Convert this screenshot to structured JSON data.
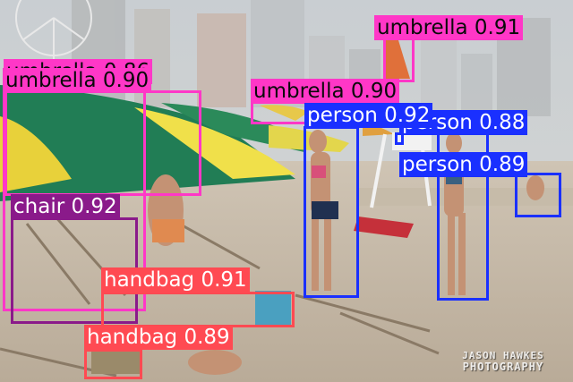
{
  "colors": {
    "umbrella": "#ff37c7",
    "person": "#1a30ff",
    "chair": "#8a1a8a",
    "handbag": "#ff4a52"
  },
  "detections": [
    {
      "label": "umbrella 0.91",
      "cls": "umbrella"
    },
    {
      "label": "umbrella 0.90",
      "cls": "umbrella"
    },
    {
      "label": "umbrella 0.90",
      "cls": "umbrella"
    },
    {
      "label": "umbrella 0.86",
      "cls": "umbrella"
    },
    {
      "label": "person 0.92",
      "cls": "person"
    },
    {
      "label": "person 0.88",
      "cls": "person"
    },
    {
      "label": "person 0.89",
      "cls": "person"
    },
    {
      "label": "person",
      "cls": "person"
    },
    {
      "label": "chair 0.92",
      "cls": "chair"
    },
    {
      "label": "handbag 0.91",
      "cls": "handbag"
    },
    {
      "label": "handbag 0.89",
      "cls": "handbag"
    }
  ],
  "watermark": {
    "line1": "JASON HAWKES",
    "line2": "PHOTOGRAPHY"
  }
}
